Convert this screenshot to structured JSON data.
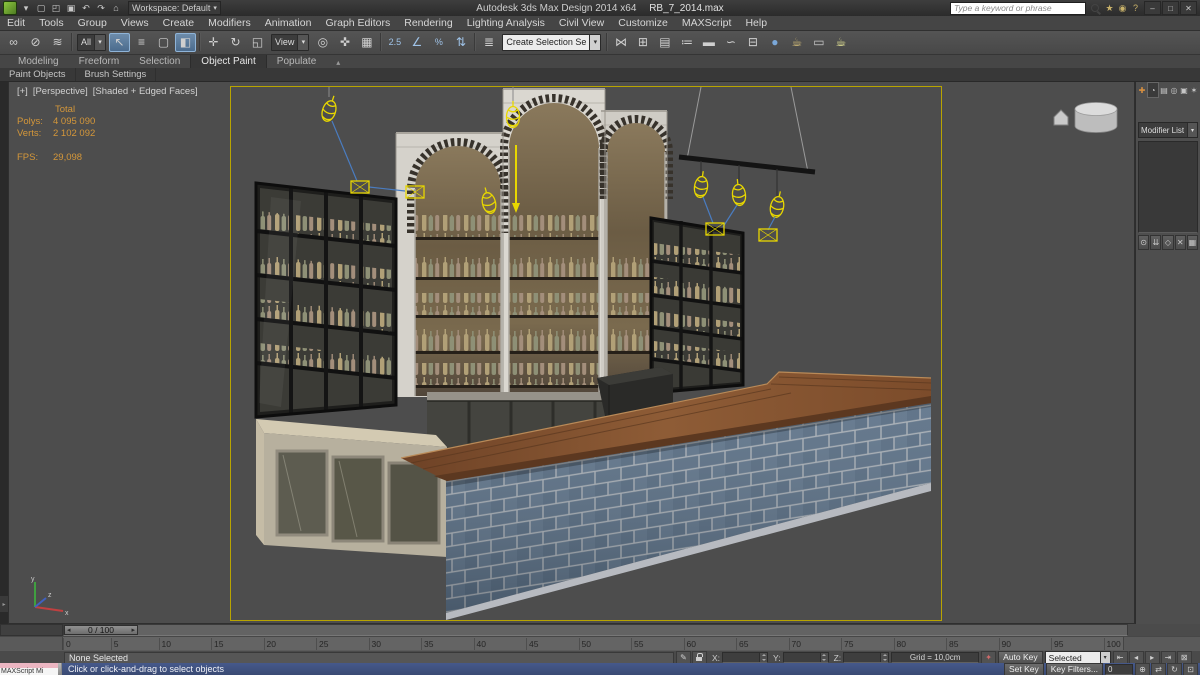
{
  "icons": {
    "caret": "▾"
  },
  "palette": {
    "accent_yellow": "#e8d700",
    "selection_blue": "#4a7cc0",
    "safe_frame_yellow": "#b8a400",
    "stats_orange": "#d4973a",
    "tile_blue": "#5a6f85",
    "wood_brown": "#8e5c36",
    "counter_beige": "#d3cab2",
    "viewport_gray": "#4d4d4d"
  },
  "titlebar": {
    "app_title": "Autodesk 3ds Max Design 2014 x64",
    "file_name": "RB_7_2014.max",
    "workspace": "Workspace: Default",
    "search_placeholder": "Type a keyword or phrase",
    "qat_icons": [
      {
        "name": "app-menu-arrow-icon",
        "glyph": "▾"
      },
      {
        "name": "new-scene-icon",
        "glyph": "▢"
      },
      {
        "name": "open-file-icon",
        "glyph": "◰"
      },
      {
        "name": "save-file-icon",
        "glyph": "▣"
      },
      {
        "name": "undo-icon",
        "glyph": "↶"
      },
      {
        "name": "redo-icon",
        "glyph": "↷"
      },
      {
        "name": "project-folder-icon",
        "glyph": "⌂"
      }
    ],
    "infocenter_icons": [
      {
        "name": "favorites-star-icon",
        "glyph": "★"
      },
      {
        "name": "communication-center-icon",
        "glyph": "◉"
      },
      {
        "name": "help-icon",
        "glyph": "?"
      }
    ],
    "window_buttons": [
      {
        "name": "minimize-button",
        "glyph": "–"
      },
      {
        "name": "restore-button",
        "glyph": "□"
      },
      {
        "name": "close-button",
        "glyph": "✕"
      }
    ]
  },
  "menubar": {
    "items": [
      {
        "name": "menu-edit",
        "label": "Edit"
      },
      {
        "name": "menu-tools",
        "label": "Tools"
      },
      {
        "name": "menu-group",
        "label": "Group"
      },
      {
        "name": "menu-views",
        "label": "Views"
      },
      {
        "name": "menu-create",
        "label": "Create"
      },
      {
        "name": "menu-modifiers",
        "label": "Modifiers"
      },
      {
        "name": "menu-animation",
        "label": "Animation"
      },
      {
        "name": "menu-graph-editors",
        "label": "Graph Editors"
      },
      {
        "name": "menu-rendering",
        "label": "Rendering"
      },
      {
        "name": "menu-lighting-analysis",
        "label": "Lighting Analysis"
      },
      {
        "name": "menu-civil-view",
        "label": "Civil View"
      },
      {
        "name": "menu-customize",
        "label": "Customize"
      },
      {
        "name": "menu-maxscript",
        "label": "MAXScript"
      },
      {
        "name": "menu-help",
        "label": "Help"
      }
    ]
  },
  "toolbar": {
    "items": [
      {
        "name": "select-and-link-icon",
        "glyph": "∞"
      },
      {
        "name": "unlink-selection-icon",
        "glyph": "⊘"
      },
      {
        "name": "bind-to-space-warp-icon",
        "glyph": "≋"
      },
      {
        "name": "toolbar-separator",
        "cls": "sep"
      },
      {
        "name": "selection-filter-combo",
        "label": "All",
        "cls": "combo-dark"
      },
      {
        "name": "select-object-icon",
        "glyph": "↖",
        "cls": "active"
      },
      {
        "name": "select-by-name-icon",
        "glyph": "≡"
      },
      {
        "name": "selection-region-icon",
        "glyph": "▢"
      },
      {
        "name": "window-crossing-toggle-icon",
        "glyph": "◧",
        "cls": "active"
      },
      {
        "name": "toolbar-separator",
        "cls": "sep"
      },
      {
        "name": "select-and-move-icon",
        "glyph": "✛"
      },
      {
        "name": "select-and-rotate-icon",
        "glyph": "↻"
      },
      {
        "name": "select-and-scale-icon",
        "glyph": "◱"
      },
      {
        "name": "reference-coordinate-combo",
        "label": "View",
        "cls": "combo-dark"
      },
      {
        "name": "use-pivot-point-icon",
        "glyph": "◎"
      },
      {
        "name": "select-and-manipulate-icon",
        "glyph": "✜"
      },
      {
        "name": "keyboard-shortcut-override-icon",
        "glyph": "▦"
      },
      {
        "name": "toolbar-separator",
        "cls": "sep"
      },
      {
        "name": "snaps-toggle-icon",
        "glyph": "2.5",
        "cls": "sm",
        "color": "#9fc3e8"
      },
      {
        "name": "angle-snap-toggle-icon",
        "glyph": "∠",
        "color": "#9fc3e8"
      },
      {
        "name": "percent-snap-toggle-icon",
        "glyph": "%",
        "cls": "sm",
        "color": "#9fc3e8"
      },
      {
        "name": "spinner-snap-toggle-icon",
        "glyph": "⇅",
        "color": "#9fc3e8"
      },
      {
        "name": "toolbar-separator",
        "cls": "sep"
      },
      {
        "name": "edit-named-selection-sets-icon",
        "glyph": "≣"
      },
      {
        "name": "named-selection-sets-combo",
        "label": "Create Selection Se",
        "cls": "combo-light"
      },
      {
        "name": "toolbar-separator",
        "cls": "sep"
      },
      {
        "name": "mirror-icon",
        "glyph": "⋈"
      },
      {
        "name": "align-icon",
        "glyph": "⊞"
      },
      {
        "name": "toggle-scene-explorer-icon",
        "glyph": "▤"
      },
      {
        "name": "toggle-layer-explorer-icon",
        "glyph": "≔"
      },
      {
        "name": "toggle-ribbon-icon",
        "glyph": "▬"
      },
      {
        "name": "curve-editor-icon",
        "glyph": "∽"
      },
      {
        "name": "schematic-view-icon",
        "glyph": "⊟"
      },
      {
        "name": "material-editor-icon",
        "glyph": "●",
        "color": "#7aa7d8"
      },
      {
        "name": "render-setup-icon",
        "glyph": "☕",
        "color": "#d8c07a"
      },
      {
        "name": "rendered-frame-window-icon",
        "glyph": "▭",
        "color": "#c8c8c8"
      },
      {
        "name": "render-production-icon",
        "glyph": "☕",
        "color": "#eded9a"
      }
    ]
  },
  "ribbon": {
    "tabs": [
      {
        "name": "ribbon-tab-modeling",
        "label": "Modeling"
      },
      {
        "name": "ribbon-tab-freeform",
        "label": "Freeform"
      },
      {
        "name": "ribbon-tab-selection",
        "label": "Selection"
      },
      {
        "name": "ribbon-tab-object-paint",
        "label": "Object Paint",
        "cls": "active"
      },
      {
        "name": "ribbon-tab-populate",
        "label": "Populate"
      },
      {
        "name": "ribbon-minimize-icon",
        "glyph": "▴",
        "cls": "rmin"
      }
    ],
    "subtabs": [
      {
        "name": "subtab-paint-objects",
        "label": "Paint Objects"
      },
      {
        "name": "subtab-brush-settings",
        "label": "Brush Settings"
      }
    ]
  },
  "viewport": {
    "labels": {
      "general": "[+]",
      "pov": "[Perspective]",
      "shading": "[Shaded + Edged Faces]"
    },
    "stats": {
      "total": "Total",
      "polys_label": "Polys:",
      "polys_value": "4 095 090",
      "verts_label": "Verts:",
      "verts_value": "2 102 092",
      "fps_label": "FPS:",
      "fps_value": "29,098"
    }
  },
  "command_panel": {
    "tabs": [
      {
        "name": "create-tab-icon",
        "glyph": "✚",
        "color": "#d89040"
      },
      {
        "name": "modify-tab-icon",
        "glyph": "◔",
        "cls": "active"
      },
      {
        "name": "hierarchy-tab-icon",
        "glyph": "▤"
      },
      {
        "name": "motion-tab-icon",
        "glyph": "◎"
      },
      {
        "name": "display-tab-icon",
        "glyph": "▣"
      },
      {
        "name": "utilities-tab-icon",
        "glyph": "✶"
      }
    ],
    "modifier_list": "Modifier List",
    "stack_buttons": [
      {
        "name": "pin-stack-icon",
        "glyph": "⊙"
      },
      {
        "name": "show-end-result-icon",
        "glyph": "⇊"
      },
      {
        "name": "make-unique-icon",
        "glyph": "◇"
      },
      {
        "name": "remove-modifier-icon",
        "glyph": "✕"
      },
      {
        "name": "configure-modifier-sets-icon",
        "glyph": "▦"
      }
    ]
  },
  "timeline": {
    "handle": "0 / 100",
    "ticks": [
      "0",
      "5",
      "10",
      "15",
      "20",
      "25",
      "30",
      "35",
      "40",
      "45",
      "50",
      "55",
      "60",
      "65",
      "70",
      "75",
      "80",
      "85",
      "90",
      "95",
      "100"
    ]
  },
  "status": {
    "selection": "None Selected",
    "x_label": "X:",
    "y_label": "Y:",
    "z_label": "Z:",
    "grid": "Grid = 10,0cm",
    "auto_key": "Auto Key",
    "set_key": "Set Key",
    "selected_combo": "Selected",
    "key_filters": "Key Filters...",
    "frame": "0",
    "prompt": "Click or click-and-drag to select objects",
    "maxscript_label": "MAXScript Mi",
    "mid_icons": [
      {
        "name": "transform-typein-pencil-icon",
        "glyph": "✎"
      },
      {
        "name": "selection-lock-icon",
        "cls": "padlock"
      }
    ],
    "key_mode_icons": [
      {
        "name": "set-key-mode-icon",
        "glyph": "✦",
        "color": "#d06a6a"
      }
    ],
    "transport": [
      {
        "name": "go-to-start-button",
        "glyph": "⇤"
      },
      {
        "name": "previous-frame-button",
        "glyph": "◂"
      },
      {
        "name": "play-animation-button",
        "glyph": "▸"
      },
      {
        "name": "go-to-end-button",
        "glyph": "⇥"
      },
      {
        "name": "zoom-extents-button",
        "glyph": "⊠"
      }
    ],
    "nav": [
      {
        "name": "zoom-view-button",
        "glyph": "⊕"
      },
      {
        "name": "pan-view-button",
        "glyph": "⇄"
      },
      {
        "name": "orbit-view-button",
        "glyph": "↻"
      },
      {
        "name": "maximize-viewport-toggle",
        "glyph": "⊡"
      }
    ]
  }
}
